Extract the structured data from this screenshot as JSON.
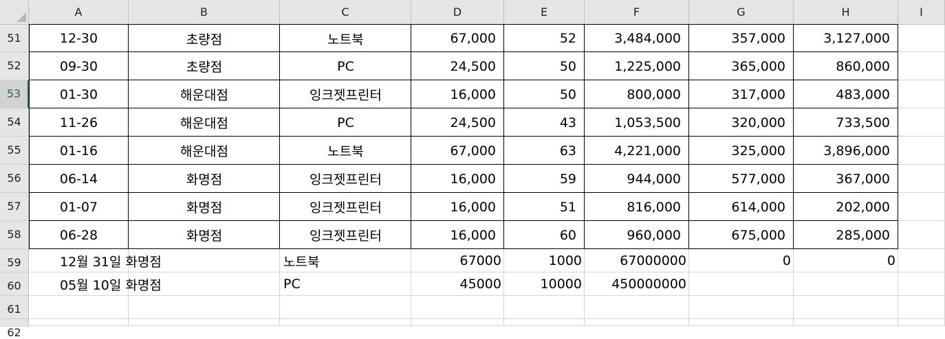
{
  "columns": [
    "A",
    "B",
    "C",
    "D",
    "E",
    "F",
    "G",
    "H",
    "I"
  ],
  "row_numbers": [
    "51",
    "52",
    "53",
    "54",
    "55",
    "56",
    "57",
    "58",
    "59",
    "60",
    "61",
    "62"
  ],
  "selected_row": "53",
  "table_rows": [
    {
      "row": "51",
      "date": "12-30",
      "branch": "초량점",
      "product": "노트북",
      "price": "67,000",
      "qty": "52",
      "total": "3,484,000",
      "g": "357,000",
      "h": "3,127,000"
    },
    {
      "row": "52",
      "date": "09-30",
      "branch": "초량점",
      "product": "PC",
      "price": "24,500",
      "qty": "50",
      "total": "1,225,000",
      "g": "365,000",
      "h": "860,000"
    },
    {
      "row": "53",
      "date": "01-30",
      "branch": "해운대점",
      "product": "잉크젯프린터",
      "price": "16,000",
      "qty": "50",
      "total": "800,000",
      "g": "317,000",
      "h": "483,000"
    },
    {
      "row": "54",
      "date": "11-26",
      "branch": "해운대점",
      "product": "PC",
      "price": "24,500",
      "qty": "43",
      "total": "1,053,500",
      "g": "320,000",
      "h": "733,500"
    },
    {
      "row": "55",
      "date": "01-16",
      "branch": "해운대점",
      "product": "노트북",
      "price": "67,000",
      "qty": "63",
      "total": "4,221,000",
      "g": "325,000",
      "h": "3,896,000"
    },
    {
      "row": "56",
      "date": "06-14",
      "branch": "화명점",
      "product": "잉크젯프린터",
      "price": "16,000",
      "qty": "59",
      "total": "944,000",
      "g": "577,000",
      "h": "367,000"
    },
    {
      "row": "57",
      "date": "01-07",
      "branch": "화명점",
      "product": "잉크젯프린터",
      "price": "16,000",
      "qty": "51",
      "total": "816,000",
      "g": "614,000",
      "h": "202,000"
    },
    {
      "row": "58",
      "date": "06-28",
      "branch": "화명점",
      "product": "잉크젯프린터",
      "price": "16,000",
      "qty": "60",
      "total": "960,000",
      "g": "675,000",
      "h": "285,000"
    }
  ],
  "extra_rows": [
    {
      "row": "59",
      "a": "12월 31일 화명점",
      "c": "노트북",
      "d": "67000",
      "e": "1000",
      "f": "67000000",
      "g": "0",
      "h": "0"
    },
    {
      "row": "60",
      "a": "05월 10일 화명점",
      "c": "PC",
      "d": "45000",
      "e": "10000",
      "f": "450000000",
      "g": "",
      "h": ""
    }
  ]
}
